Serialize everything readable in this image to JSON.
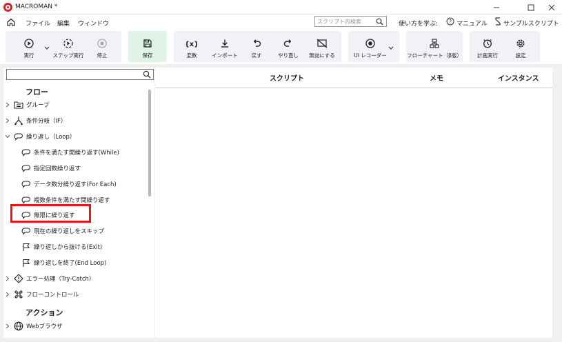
{
  "window": {
    "title": "MACROMAN *"
  },
  "menu": {
    "items": [
      "ファイル",
      "編集",
      "ウィンドウ"
    ],
    "search_placeholder": "スクリプト内検索",
    "help": "使い方を学ぶ:",
    "manual": "マニュアル",
    "samples": "サンプルスクリプト"
  },
  "toolbar": {
    "run": "実行",
    "step": "ステップ実行",
    "stop": "停止",
    "save": "保存",
    "variable": "変数",
    "import": "インポート",
    "undo": "戻す",
    "redo": "やり直し",
    "disable": "無効にする",
    "ui_recorder": "UI レコーダー",
    "flowchart": "フローチャート（β版）",
    "schedule": "計画実行",
    "settings": "設定"
  },
  "tree": {
    "section_flow": "フロー",
    "group": "グループ",
    "if": "条件分岐（IF）",
    "loop": "繰り返し（Loop）",
    "while": "条件を満たす間繰り返す(While)",
    "count": "指定回数繰り返す",
    "foreach": "データ数分繰り返す(For Each)",
    "multi": "複数条件を満たす間繰り返す",
    "infinite": "無限に繰り返す",
    "skip": "現在の繰り返しをスキップ",
    "exit": "繰り返しから抜ける(Exit)",
    "end": "繰り返しを終了(End Loop)",
    "trycatch": "エラー処理（Try-Catch）",
    "flowcontrol": "フローコントロール",
    "section_action": "アクション",
    "browser": "Webブラウザ"
  },
  "table": {
    "col_script": "スクリプト",
    "col_memo": "メモ",
    "col_instance": "インスタンス"
  },
  "colors": {
    "brand_red": "#c8262c",
    "highlight_red": "#e0161a",
    "toolbar_bg": "#f0f2f7",
    "save_bg": "#dff3e6"
  }
}
